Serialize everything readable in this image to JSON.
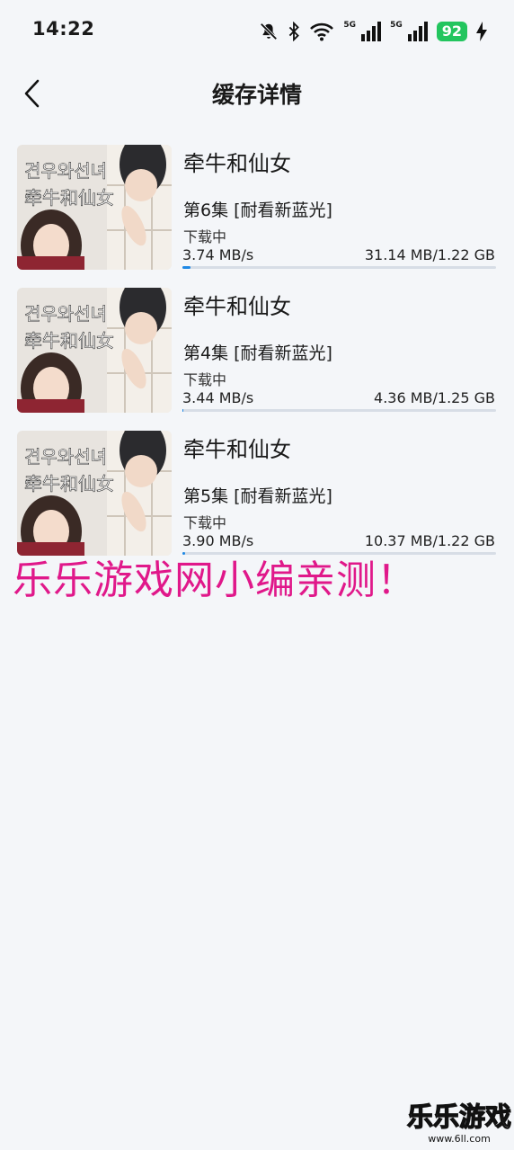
{
  "status_bar": {
    "time": "14:22",
    "signal_label_1": "5G",
    "signal_label_2": "5G",
    "battery": "92",
    "icons": [
      "bell-off-icon",
      "bluetooth-icon",
      "wifi-icon",
      "signal-5g-icon",
      "signal-5g-icon",
      "battery-icon",
      "charging-icon"
    ]
  },
  "header": {
    "title": "缓存详情",
    "back_icon": "chevron-left-icon"
  },
  "tasks": [
    {
      "title": "牵牛和仙女",
      "episode": "第6集 [耐看新蓝光]",
      "status": "下载中",
      "speed": "3.74 MB/s",
      "size": "31.14 MB/1.22 GB",
      "progress": 0.025
    },
    {
      "title": "牵牛和仙女",
      "episode": "第4集 [耐看新蓝光]",
      "status": "下载中",
      "speed": "3.44 MB/s",
      "size": "4.36 MB/1.25 GB",
      "progress": 0.004
    },
    {
      "title": "牵牛和仙女",
      "episode": "第5集 [耐看新蓝光]",
      "status": "下载中",
      "speed": "3.90 MB/s",
      "size": "10.37 MB/1.22 GB",
      "progress": 0.008
    }
  ],
  "thumbnail": {
    "korean_title": "견우와선녀",
    "chinese_title": "牵牛和仙女"
  },
  "watermark": {
    "caption": "乐乐游戏网小编亲测！",
    "logo_text": "乐乐游戏",
    "logo_url": "www.6ll.com"
  },
  "colors": {
    "accent": "#1e88e5",
    "battery": "#22c55e",
    "watermark": "#e0188a"
  }
}
